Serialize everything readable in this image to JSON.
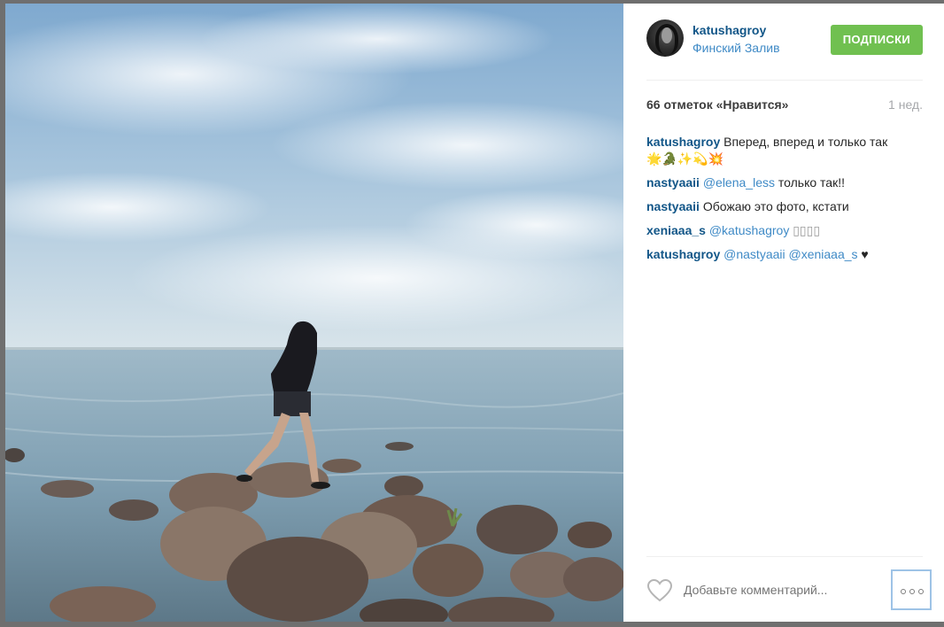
{
  "post": {
    "username": "katushagroy",
    "location": "Финский Залив",
    "follow_label": "ПОДПИСКИ",
    "likes": "66 отметок «Нравится»",
    "time": "1 нед."
  },
  "comments": [
    {
      "user": "katushagroy",
      "mention": "",
      "text": " Вперед, вперед и только так",
      "extra": "🌟🐊✨💫💥"
    },
    {
      "user": "nastyaaii",
      "mention": " @elena_less",
      "text": " только так!!",
      "extra": ""
    },
    {
      "user": "nastyaaii",
      "mention": "",
      "text": " Обожаю это фото, кстати",
      "extra": ""
    },
    {
      "user": "xeniaaa_s",
      "mention": " @katushagroy",
      "text": " ▯▯▯▯",
      "extra": ""
    },
    {
      "user": "katushagroy",
      "mention": " @nastyaaii @xeniaaa_s",
      "text": " ♥",
      "extra": ""
    }
  ],
  "comment_box": {
    "placeholder": "Добавьте комментарий..."
  },
  "icons": {
    "like": "heart-icon",
    "more": "more-options-icon"
  },
  "colors": {
    "username": "#125688",
    "link": "#3f8ac6",
    "follow_button": "#70c050",
    "muted": "#a5a7aa"
  }
}
